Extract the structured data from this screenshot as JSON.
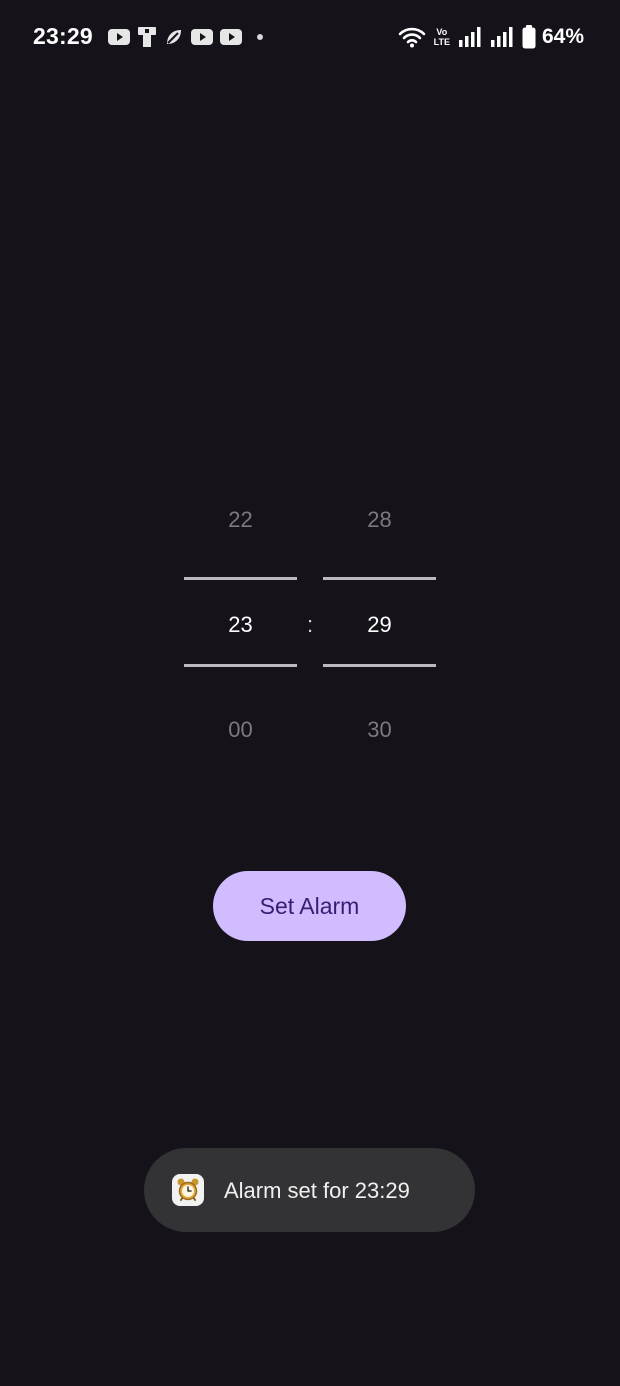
{
  "status_bar": {
    "time": "23:29",
    "notification_icons": [
      "youtube-icon",
      "phone-app-icon",
      "leaf-app-icon",
      "youtube-icon",
      "youtube-icon",
      "more-dot-icon"
    ],
    "system_icons": [
      "wifi-icon",
      "volte-icon",
      "signal-icon",
      "signal-icon",
      "battery-icon"
    ],
    "volte_top": "Vo",
    "volte_bottom": "LTE",
    "battery_percent": "64%"
  },
  "time_picker": {
    "hours": {
      "previous": "22",
      "current": "23",
      "next": "00"
    },
    "separator": ":",
    "minutes": {
      "previous": "28",
      "current": "29",
      "next": "30"
    }
  },
  "actions": {
    "set_alarm_label": "Set Alarm"
  },
  "toast": {
    "icon": "alarm-clock-icon",
    "message": "Alarm set for 23:29"
  },
  "colors": {
    "background": "#15121a",
    "button_background": "#d0bcff",
    "button_text": "#381e72",
    "toast_background": "#333336",
    "picker_divider": "#bdb8c2",
    "picker_faded_text": "#7c7980"
  }
}
